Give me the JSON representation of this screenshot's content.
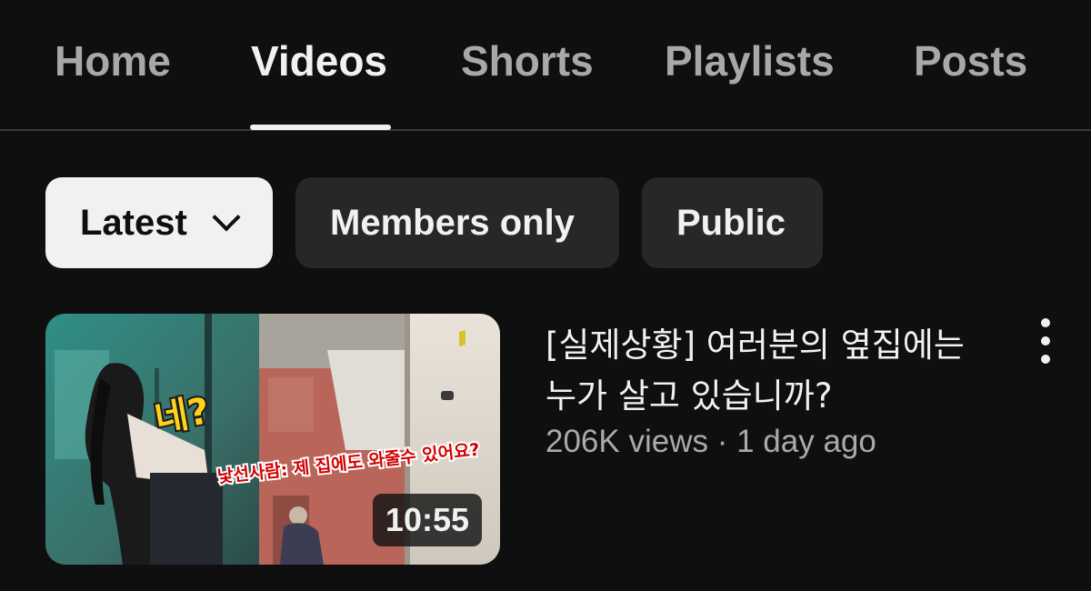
{
  "tabs": [
    {
      "label": "Home",
      "active": false
    },
    {
      "label": "Videos",
      "active": true
    },
    {
      "label": "Shorts",
      "active": false
    },
    {
      "label": "Playlists",
      "active": false
    },
    {
      "label": "Posts",
      "active": false
    }
  ],
  "chips": {
    "sort": {
      "label": "Latest",
      "icon": "chevron-down-icon",
      "selected": true
    },
    "members": {
      "label": "Members only"
    },
    "public": {
      "label": "Public"
    }
  },
  "video": {
    "title_line1": "[실제상황] 여러분의 옆집에는",
    "title_line2": "누가 살고 있습니까?",
    "views": "206K views",
    "separator": "·",
    "age": "1 day ago",
    "duration": "10:55",
    "thumbnail_overlay_question": "네?",
    "thumbnail_overlay_caption": "낯선사람: 제 집에도 와줄수 있어요?",
    "menu_icon": "more-vert-icon"
  },
  "colors": {
    "background": "#0f0f0f",
    "chip_bg": "#272727",
    "chip_selected_bg": "#f1f1f1",
    "text_primary": "#f1f1f1",
    "text_secondary": "#aaaaaa",
    "overlay_yellow": "#ffd21a",
    "overlay_red": "#d40000"
  }
}
